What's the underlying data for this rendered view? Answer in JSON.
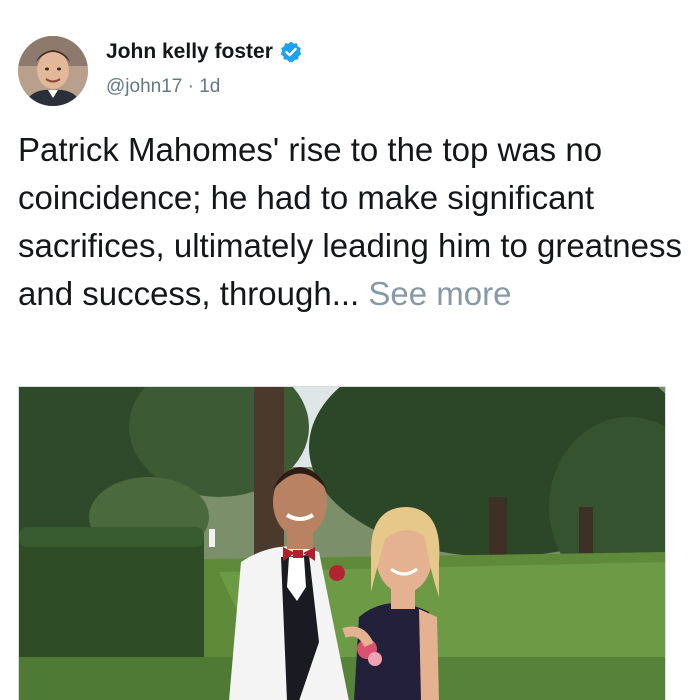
{
  "tweet": {
    "author": {
      "display_name": "John kelly foster",
      "handle": "@john17",
      "verified": true,
      "avatar_icon": "profile-photo"
    },
    "separator": " · ",
    "time_ago": "1d",
    "text": "Patrick Mahomes' rise to the top was no coincidence; he had to make significant sacrifices, ultimately leading him to greatness and success, through...",
    "see_more_label": "See more",
    "media": {
      "type": "photo",
      "icon": "prom-photo"
    }
  },
  "colors": {
    "text": "#14171a",
    "secondary": "#657786",
    "see_more": "#8899a6",
    "verified": "#1da1f2"
  }
}
